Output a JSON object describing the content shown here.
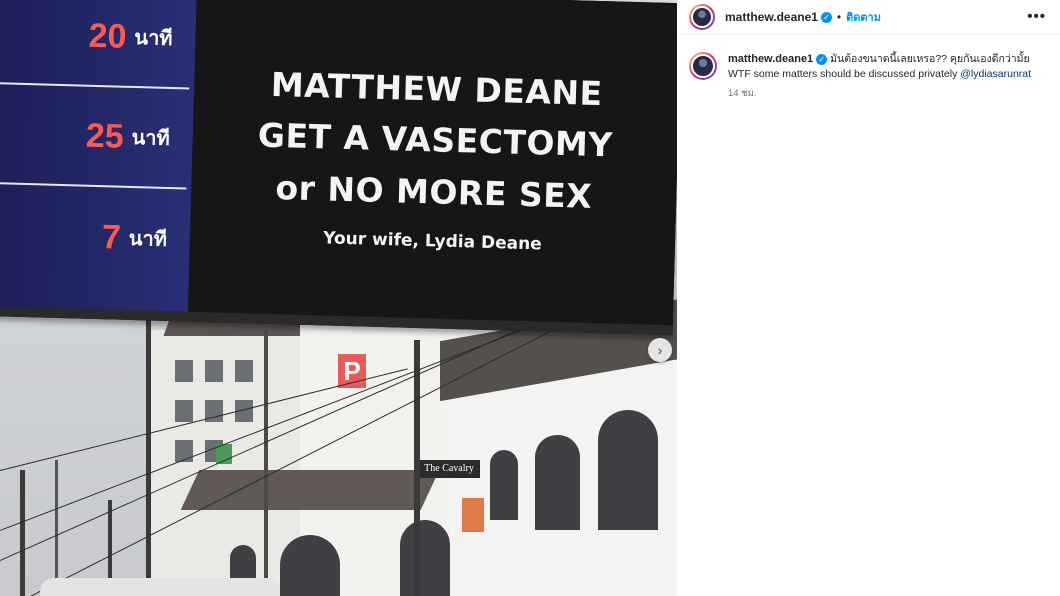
{
  "billboard": {
    "rows": [
      {
        "number": "20",
        "unit": "นาที"
      },
      {
        "number": "25",
        "unit": "นาที"
      },
      {
        "number": "7",
        "unit": "นาที"
      }
    ],
    "line1": "MATTHEW DEANE",
    "line2": "GET A VASECTOMY",
    "line3": "or NO MORE SEX",
    "signature": "Your wife, Lydia Deane"
  },
  "street_signs": {
    "cavalry": "The Cavalry",
    "letter": "P"
  },
  "header": {
    "username": "matthew.deane1",
    "separator": "•",
    "follow_label": "ติดตาม",
    "more_label": "•••"
  },
  "caption": {
    "username": "matthew.deane1",
    "line1": "มันต้องขนาดนี้เลยเหรอ?? คุยกันเองดีกว่ามั้ย",
    "line2": "WTF some matters should be discussed privately",
    "mention": "@lydiasarunrat",
    "time": "14 ชม."
  },
  "colors": {
    "accent": "#0095f6",
    "billboard_red": "#ff5a4e",
    "billboard_blue": "#292f77"
  },
  "icons": {
    "verified": "verified-badge-icon",
    "next": "chevron-right-icon",
    "more": "more-options-icon"
  }
}
